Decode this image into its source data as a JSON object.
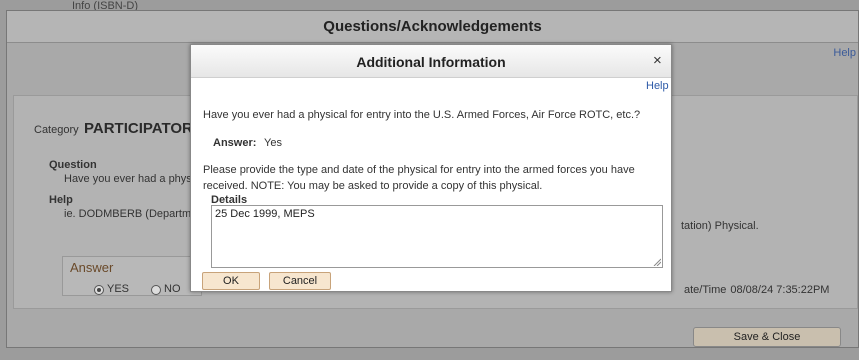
{
  "background": {
    "partial_text": "Info (ISBN-D)"
  },
  "outer_modal": {
    "title": "Questions/Acknowledgements",
    "help_link": "Help",
    "category_label": "Category",
    "category_value": "PARTICIPATORY",
    "question_label": "Question",
    "question_text": "Have you ever had a physi",
    "help_label": "Help",
    "help_text": "ie. DODMBERB (Departm",
    "help_text_tail": "tation) Physical.",
    "answer_label": "Answer",
    "yes_label": "YES",
    "no_label": "NO",
    "selected": "YES",
    "datetime_label": "ate/Time",
    "datetime_value": "08/08/24  7:35:22PM",
    "save_close_label": "Save & Close"
  },
  "dialog": {
    "title": "Additional Information",
    "close_glyph": "×",
    "help_link": "Help",
    "question": "Have you ever had a physical for entry into the U.S. Armed Forces, Air Force ROTC, etc.?",
    "answer_label": "Answer:",
    "answer_value": "Yes",
    "instructions": "Please provide the type and date of the physical for entry into the armed forces you have received.  NOTE:  You may be asked to provide a copy of this physical.",
    "details_label": "Details",
    "details_value": "25 Dec 1999, MEPS",
    "ok_label": "OK",
    "cancel_label": "Cancel"
  },
  "colors": {
    "button_bg": "#f7e6cf",
    "button_border": "#c8a37a",
    "link": "#2d5aa8",
    "overlay": "#a9a9a9"
  }
}
